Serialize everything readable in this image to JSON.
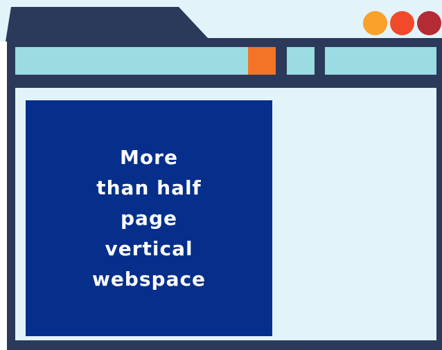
{
  "colors": {
    "frame": "#2b3a5a",
    "background": "#e2f3fa",
    "toolbar_bar": "#9bdbe2",
    "toolbar_accent": "#f47427",
    "ad_box": "#052f8a",
    "window_buttons": [
      "#f9a12b",
      "#f04a2b",
      "#b52b35"
    ]
  },
  "window_controls": [
    {
      "icon": "minimize-circle-icon",
      "color": "#f9a12b"
    },
    {
      "icon": "maximize-circle-icon",
      "color": "#f04a2b"
    },
    {
      "icon": "close-circle-icon",
      "color": "#b52b35"
    }
  ],
  "ad": {
    "text": "More\nthan half\npage\nvertical\nwebspace"
  }
}
